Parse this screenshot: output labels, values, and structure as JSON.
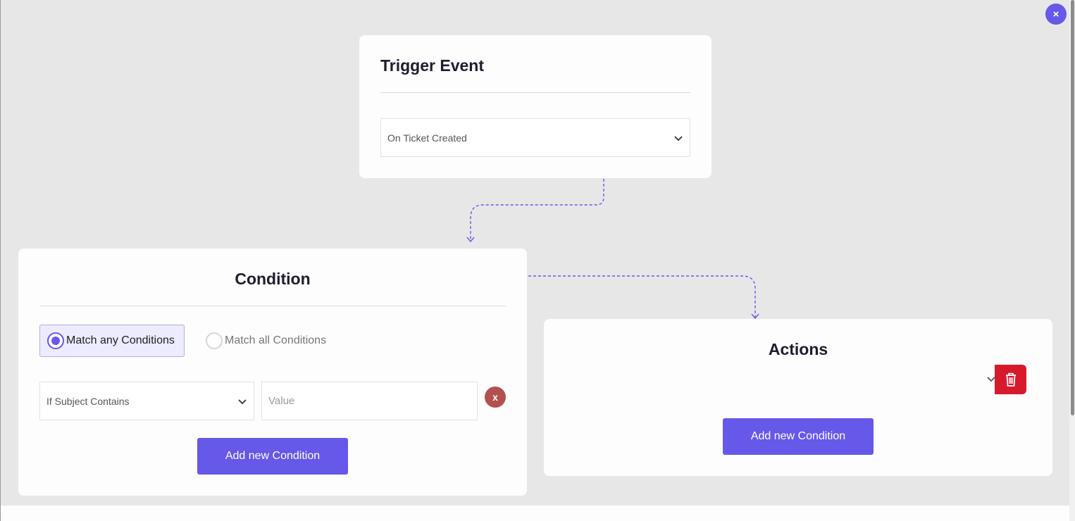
{
  "trigger": {
    "title": "Trigger Event",
    "selected_event": "On Ticket Created"
  },
  "condition": {
    "title": "Condition",
    "match_any_label": "Match any Conditions",
    "match_all_label": "Match all Conditions",
    "selected_match": "any",
    "rules": [
      {
        "field": "If Subject Contains",
        "value_placeholder": "Value",
        "remove_label": "x"
      }
    ],
    "add_button_label": "Add new Condition"
  },
  "actions": {
    "title": "Actions",
    "add_button_label": "Add new Condition"
  },
  "modal": {
    "close_label": "×"
  },
  "colors": {
    "accent": "#6658e8",
    "danger": "#d7192c",
    "remove": "#b25050",
    "background": "#e7e7e7",
    "card": "#fdfdfd"
  }
}
